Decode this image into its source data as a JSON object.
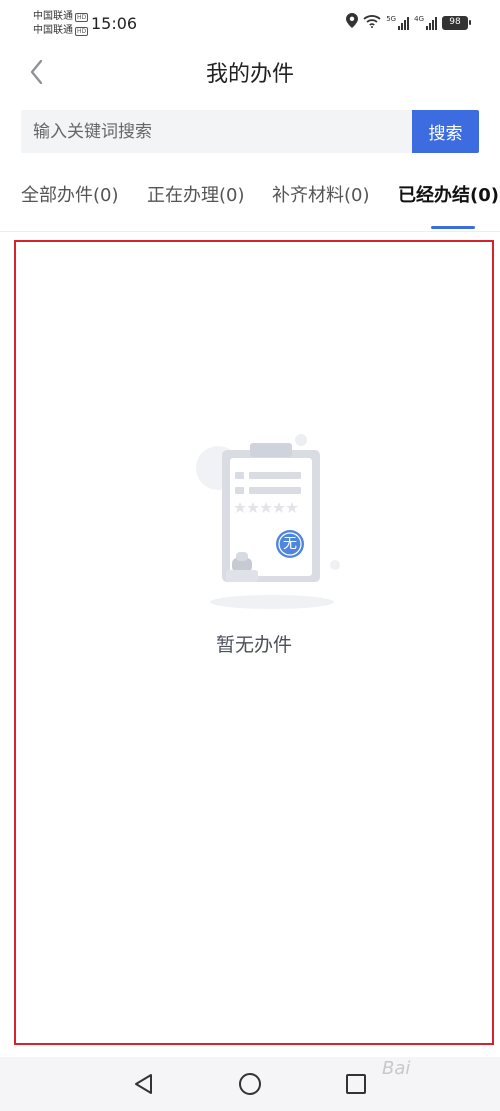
{
  "status_bar": {
    "carrier_1": "中国联通",
    "carrier_2": "中国联通",
    "hd_1": "HD",
    "hd_2": "HD",
    "time": "15:06",
    "network_1": "5G",
    "network_2": "4G",
    "battery": "98",
    "icons": [
      "location-icon",
      "wifi-icon",
      "signal-icon",
      "battery-icon"
    ]
  },
  "header": {
    "title": "我的办件",
    "back_icon": "chevron-left-icon"
  },
  "search": {
    "placeholder": "输入关键词搜索",
    "value": "",
    "button_label": "搜索"
  },
  "tabs": [
    {
      "label": "全部办件(0)",
      "active": false
    },
    {
      "label": "正在办理(0)",
      "active": false
    },
    {
      "label": "补齐材料(0)",
      "active": false
    },
    {
      "label": "已经办结(0)",
      "active": true
    }
  ],
  "empty_state": {
    "badge": "无",
    "message": "暂无办件",
    "icon": "empty-clipboard-icon"
  },
  "bottom_nav": {
    "items": [
      "back-triangle-icon",
      "home-circle-icon",
      "recents-square-icon"
    ]
  },
  "watermark": "Bai"
}
